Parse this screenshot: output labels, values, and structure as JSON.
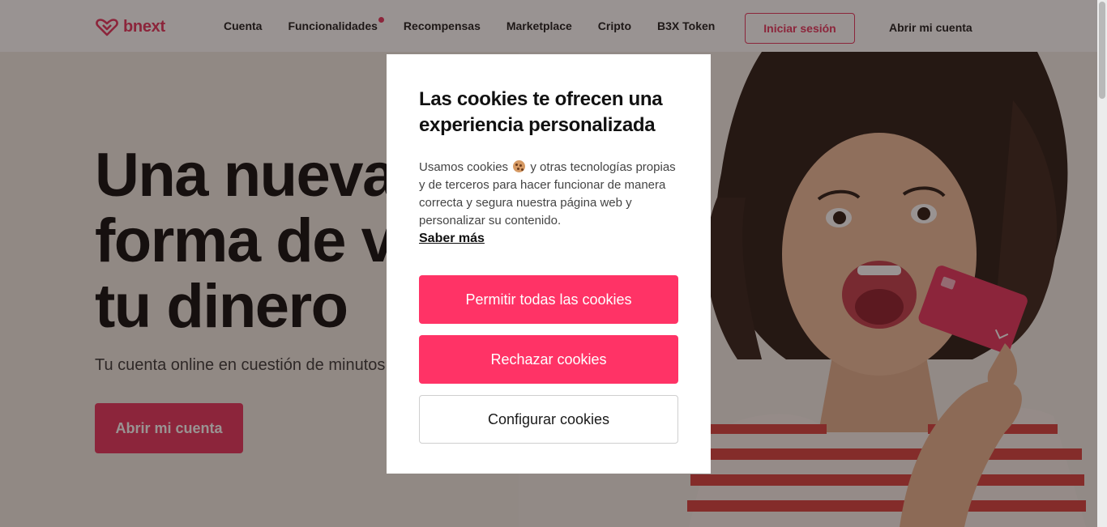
{
  "header": {
    "brand": "bnext",
    "nav": [
      {
        "label": "Cuenta"
      },
      {
        "label": "Funcionalidades",
        "badge": true
      },
      {
        "label": "Recompensas"
      },
      {
        "label": "Marketplace"
      },
      {
        "label": "Cripto"
      },
      {
        "label": "B3X Token"
      }
    ],
    "login_label": "Iniciar sesión",
    "open_account_label": "Abrir mi cuenta"
  },
  "hero": {
    "title": "Una nueva\nforma de vivir\ntu dinero",
    "subtitle": "Tu cuenta online en cuestión de minutos",
    "cta_label": "Abrir mi cuenta"
  },
  "cookie_modal": {
    "title": "Las cookies te ofrecen una experiencia personalizada",
    "body_before": "Usamos cookies",
    "body_after": "y otras tecnologías propias y de terceros para hacer funcionar de manera correcta y segura nuestra página web y personalizar su contenido.",
    "learn_more": "Saber más",
    "allow_all": "Permitir todas las cookies",
    "reject": "Rechazar cookies",
    "configure": "Configurar cookies"
  },
  "colors": {
    "brand": "#e8345e",
    "button_primary": "#ff3366",
    "overlay": "rgba(32,20,18,0.46)"
  },
  "icons": {
    "logo": "heart-logo-icon",
    "cookie": "cookie-emoji-icon"
  }
}
